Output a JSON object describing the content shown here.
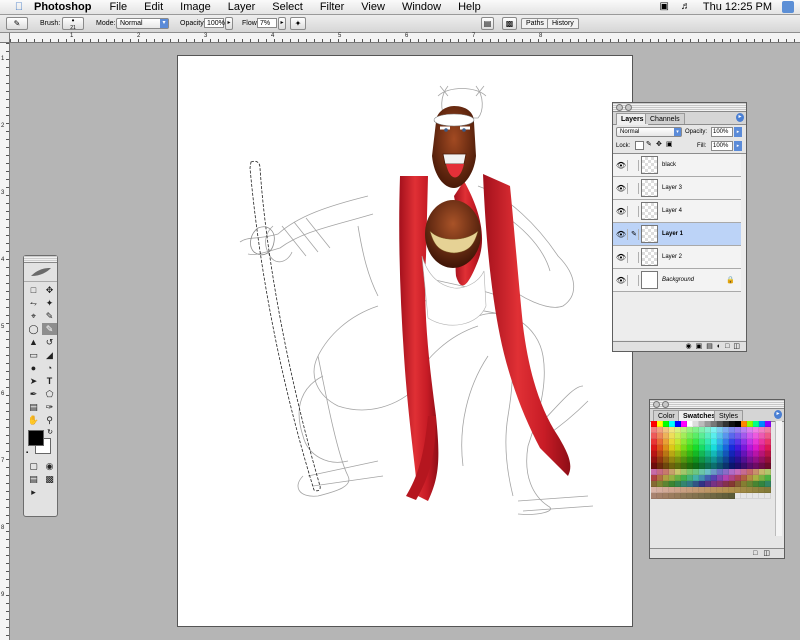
{
  "menubar": {
    "app_name": "Photoshop",
    "menus": [
      "File",
      "Edit",
      "Image",
      "Layer",
      "Select",
      "Filter",
      "View",
      "Window",
      "Help"
    ],
    "clock": "Thu 12:25 PM"
  },
  "options_bar": {
    "brush_label": "Brush:",
    "brush_size": "21",
    "mode_label": "Mode:",
    "mode_value": "Normal",
    "opacity_label": "Opacity:",
    "opacity_value": "100%",
    "flow_label": "Flow:",
    "flow_value": "7%",
    "tab_paths": "Paths",
    "tab_history": "History"
  },
  "rulers": {
    "top_numbers": [
      "1",
      "2",
      "3",
      "4",
      "5",
      "6",
      "7",
      "8"
    ],
    "left_numbers": [
      "1",
      "2",
      "3",
      "4",
      "5",
      "6",
      "7",
      "8",
      "9"
    ]
  },
  "layers_panel": {
    "tabs": [
      "Layers",
      "Channels"
    ],
    "blend_mode": "Normal",
    "opacity_label": "Opacity:",
    "opacity_value": "100%",
    "lock_label": "Lock:",
    "fill_label": "Fill:",
    "fill_value": "100%",
    "layers": [
      "black",
      "Layer 3",
      "Layer 4",
      "Layer 1",
      "Layer 2",
      "Background"
    ],
    "selected_layer": "Layer 1"
  },
  "swatches_panel": {
    "tabs": [
      "Color",
      "Swatches",
      "Styles"
    ]
  },
  "colors": {
    "foreground": "#000000",
    "background": "#ffffff",
    "selection": "#bcd3f7",
    "accent": "#4a7fd3"
  }
}
